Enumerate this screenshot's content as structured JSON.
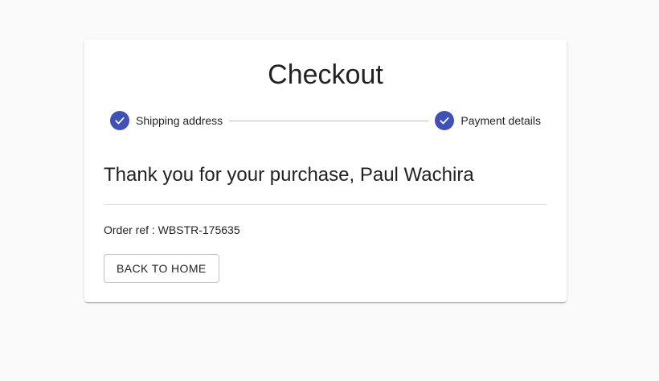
{
  "page": {
    "title": "Checkout"
  },
  "stepper": {
    "steps": [
      {
        "label": "Shipping address",
        "completed": true,
        "icon": "check-circle-icon"
      },
      {
        "label": "Payment details",
        "completed": true,
        "icon": "check-circle-icon"
      }
    ],
    "accent_color": "#3f51b5"
  },
  "confirmation": {
    "message": "Thank you for your purchase, Paul Wachira",
    "order_ref": "Order ref : WBSTR-175635"
  },
  "actions": {
    "back_home_label": "BACK TO HOME"
  }
}
